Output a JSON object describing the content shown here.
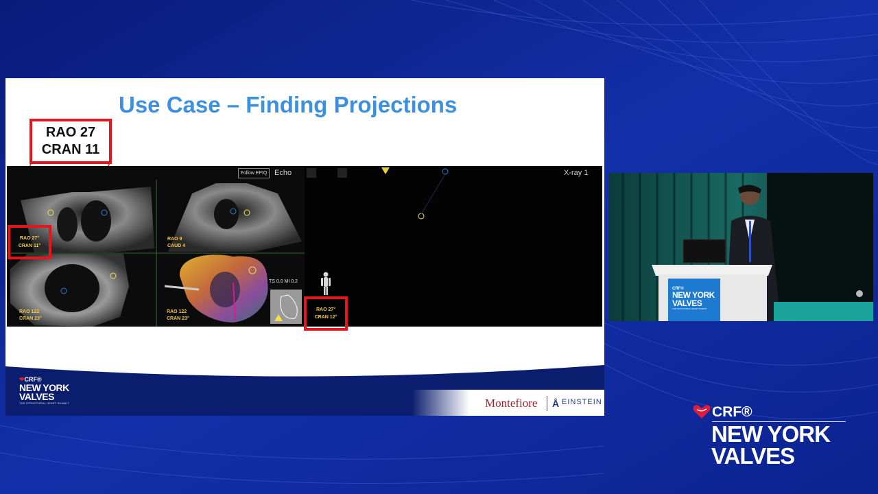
{
  "slide": {
    "title": "Use Case – Finding Projections",
    "callout": {
      "line1": "RAO 27",
      "line2": "CRAN 11"
    }
  },
  "echo_panel": {
    "follow_button": "Follow EPIQ",
    "name": "Echo",
    "views": [
      {
        "l1": "RAO 27°",
        "l2": "CRAN 11°"
      },
      {
        "l1": "RAO 9",
        "l2": "CAUD 4"
      },
      {
        "l1": "RAO 122",
        "l2": "CRAN 23°"
      },
      {
        "l1": "RAO 122",
        "l2": "CRAN 23°"
      }
    ],
    "measure": "TS 0.0  MI 0.2"
  },
  "xray_panel": {
    "name": "X-ray 1",
    "view": {
      "l1": "RAO  27°",
      "l2": "CRAN  12°"
    }
  },
  "footer": {
    "crf": "CRF®",
    "ny_line1": "NEW YORK",
    "ny_line2": "VALVES",
    "subtitle": "THE STRUCTURAL HEART SUMMIT",
    "montefiore": "Montefiore",
    "einstein": "EINSTEIN"
  },
  "speaker_video": {
    "podium_crf": "CRF®",
    "podium_line1": "NEW YORK",
    "podium_line2": "VALVES",
    "podium_sub": "THE STRUCTURAL HEART SUMMIT"
  },
  "corner_logo": {
    "crf": "CRF®",
    "line1": "NEW YORK",
    "line2": "VALVES"
  },
  "colors": {
    "title_blue": "#3d8fe0",
    "callout_red": "#e8141b",
    "brand_red": "#e21b3c",
    "navy": "#0b1d6e",
    "montefiore_red": "#b01c2e"
  }
}
